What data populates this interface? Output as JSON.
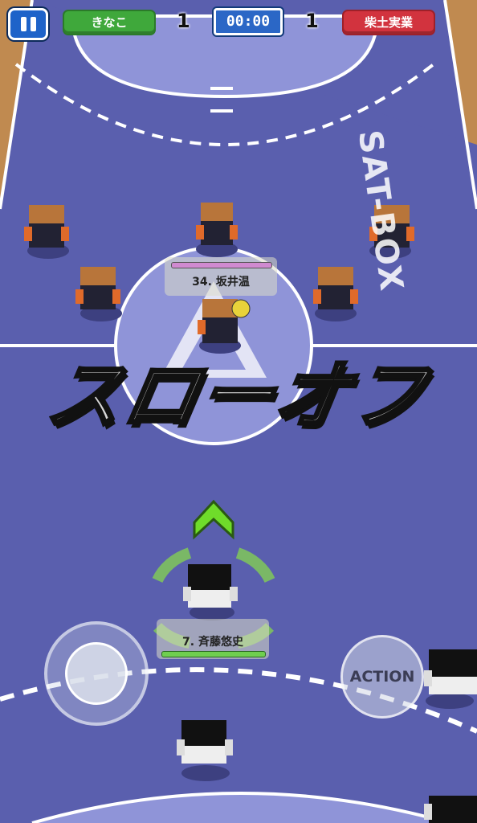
{
  "hud": {
    "team_left": "きなこ",
    "team_right": "柴土実業",
    "score_left": "1",
    "score_right": "1",
    "timer": "00:00"
  },
  "banner": {
    "text": "スローオフ"
  },
  "players": {
    "opponent_tag": "34. 坂井温",
    "own_tag": "7. 斉藤悠史"
  },
  "controls": {
    "action_label": "ACTION"
  },
  "court": {
    "wall_text": "SAT-BOX"
  },
  "colors": {
    "court": "#5a5fae",
    "team_left": "#3fa83b",
    "team_right": "#d2333e",
    "timer": "#2b67c6",
    "floor_wood": "#c08a50"
  }
}
